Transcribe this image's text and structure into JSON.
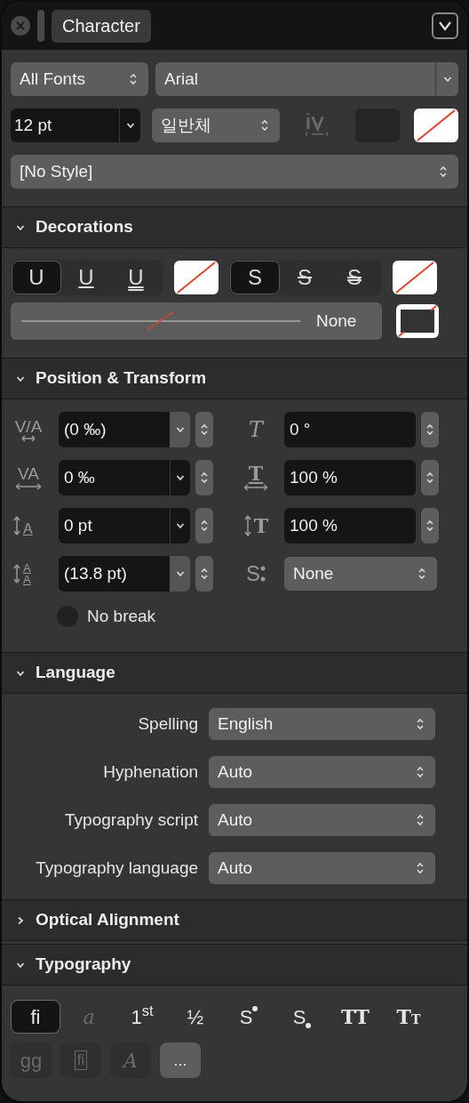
{
  "title_bar": {
    "tab": "Character",
    "collapsed": false
  },
  "font": {
    "collection": "All Fonts",
    "family": "Arial",
    "size": "12 pt",
    "style": "일반체"
  },
  "style": "[No Style]",
  "decorations": {
    "title": "Decorations",
    "expanded": true,
    "underline": [
      {
        "label": "U",
        "kind": "none",
        "selected": true
      },
      {
        "label": "U",
        "kind": "single",
        "selected": false
      },
      {
        "label": "U",
        "kind": "double",
        "selected": false
      }
    ],
    "strike": [
      {
        "label": "S",
        "kind": "none",
        "selected": true
      },
      {
        "label": "S",
        "kind": "single",
        "selected": false
      },
      {
        "label": "S",
        "kind": "double",
        "selected": false
      }
    ],
    "line_style": "None"
  },
  "position": {
    "title": "Position & Transform",
    "expanded": true,
    "left": [
      {
        "icon": "V/A",
        "kind": "kerning",
        "value": "(0 ‰)",
        "auto": true
      },
      {
        "icon": "VA",
        "kind": "tracking",
        "value": "0 ‰",
        "auto": false
      },
      {
        "icon": "A",
        "kind": "baseline",
        "value": "0 pt",
        "auto": false
      },
      {
        "icon": "A",
        "icon2": "A",
        "kind": "leading",
        "value": "(13.8 pt)",
        "auto": true
      }
    ],
    "right": [
      {
        "icon": "T",
        "kind": "skew",
        "value": "0 °"
      },
      {
        "icon": "T",
        "kind": "hscale",
        "value": "100 %"
      },
      {
        "icon": "T",
        "kind": "vscale",
        "value": "100 %"
      },
      {
        "icon": "S",
        "kind": "popup",
        "value": "None"
      }
    ],
    "no_break": {
      "label": "No break",
      "checked": false
    }
  },
  "language": {
    "title": "Language",
    "expanded": true,
    "rows": [
      {
        "label": "Spelling",
        "value": "English"
      },
      {
        "label": "Hyphenation",
        "value": "Auto"
      },
      {
        "label": "Typography script",
        "value": "Auto"
      },
      {
        "label": "Typography language",
        "value": "Auto"
      }
    ]
  },
  "optical": {
    "title": "Optical Alignment",
    "expanded": false
  },
  "typography": {
    "title": "Typography",
    "expanded": true,
    "row1": [
      {
        "kind": "text",
        "label": "fi",
        "selected": true,
        "disabled": false
      },
      {
        "kind": "italic",
        "label": "a",
        "selected": false,
        "disabled": true
      },
      {
        "kind": "rich",
        "label": "1$^{st}$",
        "selected": false,
        "disabled": false
      },
      {
        "kind": "text",
        "label": "½",
        "selected": false,
        "disabled": false
      },
      {
        "kind": "super-dot",
        "label": "S",
        "selected": false,
        "disabled": false
      },
      {
        "kind": "sub-dot",
        "label": "S",
        "selected": false,
        "disabled": false
      },
      {
        "kind": "serif",
        "label": "TT",
        "selected": false,
        "disabled": false
      },
      {
        "kind": "small-caps",
        "label": "T",
        "small": "T",
        "selected": false,
        "disabled": false
      }
    ],
    "row2": [
      {
        "kind": "text",
        "label": "gg",
        "selected": false,
        "disabled": true
      },
      {
        "kind": "framed",
        "label": "fi",
        "selected": false,
        "disabled": true
      },
      {
        "kind": "italic",
        "label": "A",
        "selected": false,
        "disabled": true
      },
      {
        "kind": "more",
        "label": "...",
        "selected": false,
        "disabled": false
      }
    ]
  }
}
